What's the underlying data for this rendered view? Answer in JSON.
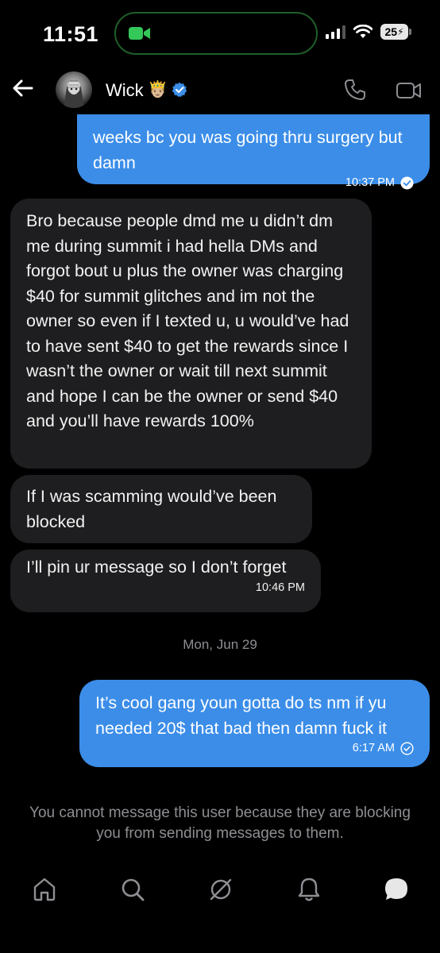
{
  "status_bar": {
    "time": "11:51",
    "battery": "25"
  },
  "header": {
    "contact_name": "Wick",
    "name_emoji": "🤴🏼",
    "verified": true
  },
  "messages": [
    {
      "direction": "outgoing",
      "text": "weeks bc you was going thru surgery but damn",
      "time": "10:37 PM",
      "status": "read"
    },
    {
      "direction": "incoming",
      "text": "Bro because people dmd me u didn’t dm me during summit i had hella DMs and forgot bout u plus the owner was charging $40 for summit glitches and im not the owner so even if I texted u, u would’ve had to have sent $40 to get the rewards since I wasn’t the owner or wait till next summit and hope I can be the owner or send $40 and you’ll have rewards 100%"
    },
    {
      "direction": "incoming",
      "text": "If I was scamming would’ve been blocked"
    },
    {
      "direction": "incoming",
      "text": "I’ll pin ur message so I don’t forget",
      "time": "10:46 PM"
    },
    {
      "direction": "outgoing",
      "text": "It’s cool gang youn gotta do ts nm if yu needed 20$ that bad then damn fuck it",
      "time": "6:17 AM",
      "status": "delivered"
    }
  ],
  "date_separator": "Mon, Jun 29",
  "blocked_notice": "You cannot message this user because they are blocking you from sending messages to them.",
  "bottom_nav": {
    "items": [
      "home-icon",
      "search-icon",
      "discover-icon",
      "notifications-icon",
      "messages-icon"
    ]
  },
  "colors": {
    "outgoing_bubble": "#3b8de8",
    "incoming_bubble": "#1e1e20",
    "background": "#000000",
    "muted_text": "#8e8e93",
    "accent": "#3b8de8"
  }
}
